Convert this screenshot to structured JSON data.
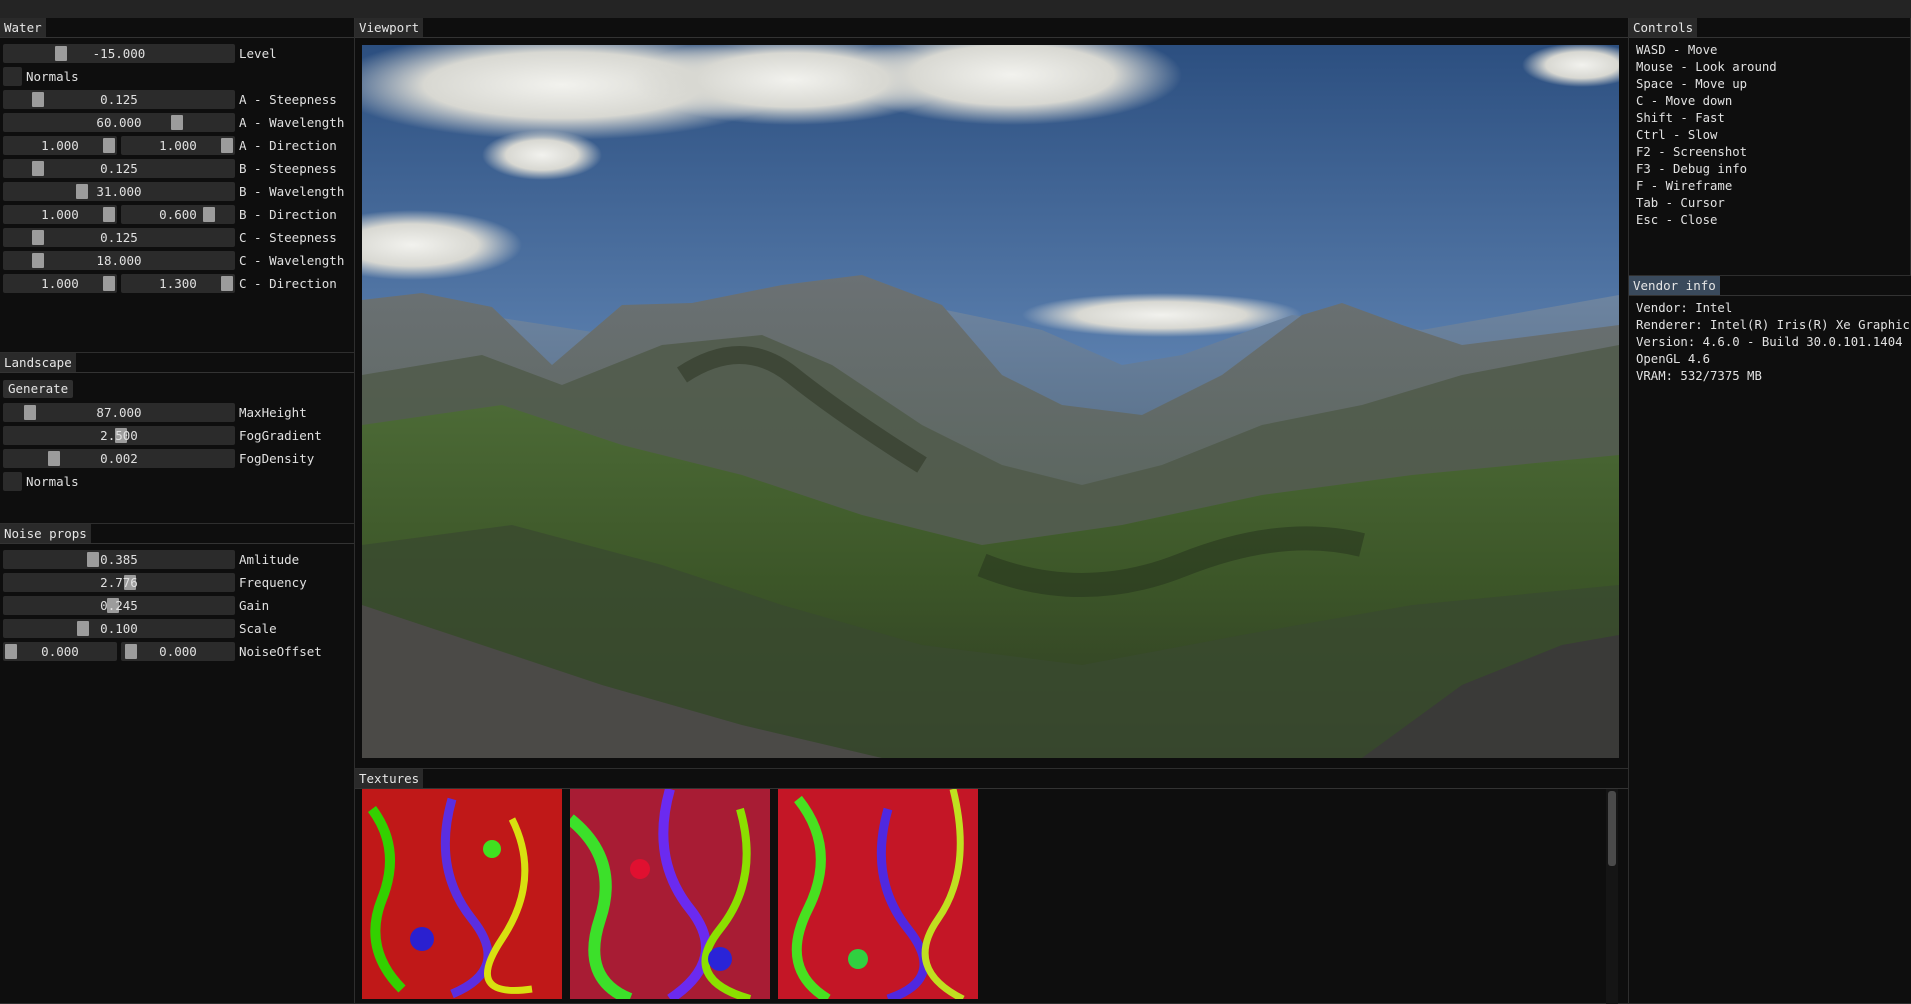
{
  "water": {
    "title": "Water",
    "level": {
      "value": "-15.000",
      "label": "Level"
    },
    "normals_label": "Normals",
    "a_steepness": {
      "value": "0.125",
      "label": "A - Steepness"
    },
    "a_wavelength": {
      "value": "60.000",
      "label": "A - Wavelength"
    },
    "a_direction": {
      "x": "1.000",
      "y": "1.000",
      "label": "A - Direction"
    },
    "b_steepness": {
      "value": "0.125",
      "label": "B - Steepness"
    },
    "b_wavelength": {
      "value": "31.000",
      "label": "B - Wavelength"
    },
    "b_direction": {
      "x": "1.000",
      "y": "0.600",
      "label": "B - Direction"
    },
    "c_steepness": {
      "value": "0.125",
      "label": "C - Steepness"
    },
    "c_wavelength": {
      "value": "18.000",
      "label": "C - Wavelength"
    },
    "c_direction": {
      "x": "1.000",
      "y": "1.300",
      "label": "C - Direction"
    }
  },
  "landscape": {
    "title": "Landscape",
    "generate_label": "Generate",
    "max_height": {
      "value": "87.000",
      "label": "MaxHeight"
    },
    "fog_gradient": {
      "value": "2.500",
      "label": "FogGradient"
    },
    "fog_density": {
      "value": "0.002",
      "label": "FogDensity"
    },
    "normals_label": "Normals"
  },
  "noise": {
    "title": "Noise props",
    "amplitude": {
      "value": "0.385",
      "label": "Amlitude"
    },
    "frequency": {
      "value": "2.776",
      "label": "Frequency"
    },
    "gain": {
      "value": "0.245",
      "label": "Gain"
    },
    "scale": {
      "value": "0.100",
      "label": "Scale"
    },
    "offset": {
      "x": "0.000",
      "y": "0.000",
      "label": "NoiseOffset"
    }
  },
  "viewport": {
    "title": "Viewport"
  },
  "textures": {
    "title": "Textures"
  },
  "controls": {
    "title": "Controls",
    "lines": [
      "WASD - Move",
      "Mouse - Look around",
      "Space - Move up",
      "C - Move down",
      "Shift - Fast",
      "Ctrl - Slow",
      "F2 - Screenshot",
      "F3 - Debug info",
      "F - Wireframe",
      "Tab - Cursor",
      "Esc - Close"
    ]
  },
  "vendor": {
    "title": "Vendor info",
    "lines": [
      "Vendor: Intel",
      "Renderer: Intel(R) Iris(R) Xe Graphics",
      "Version: 4.6.0 - Build 30.0.101.1404",
      "OpenGL 4.6",
      "VRAM: 532/7375 MB"
    ]
  },
  "colors": {
    "tab_active": "#3a4a5c",
    "slider_bg": "#2b2b2b",
    "grab": "#9c9c9c"
  },
  "icons": {
    "checkbox": "empty-checkbox"
  }
}
